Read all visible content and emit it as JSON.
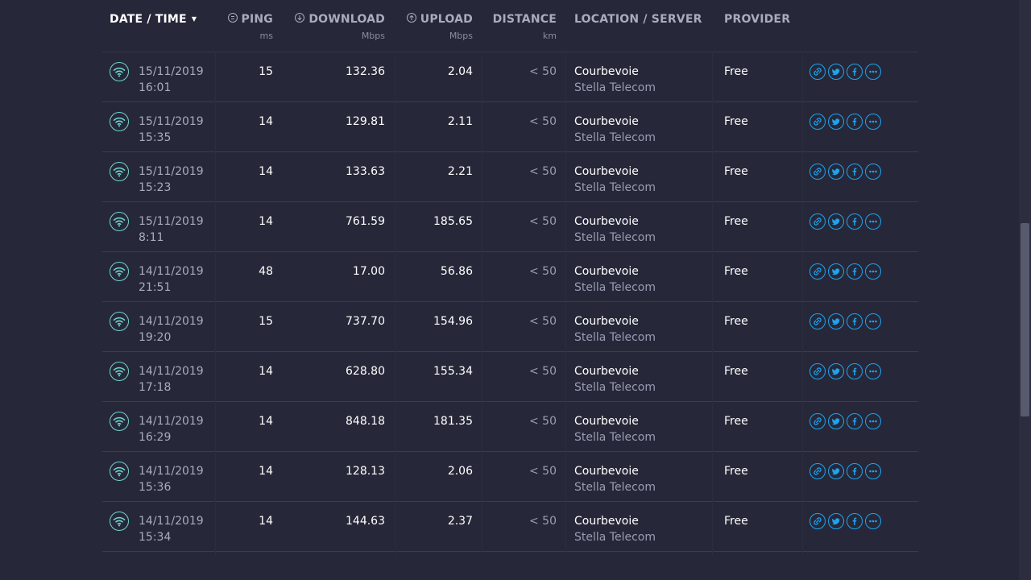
{
  "headers": {
    "datetime": "DATE / TIME",
    "ping": "PING",
    "ping_unit": "ms",
    "download": "DOWNLOAD",
    "download_unit": "Mbps",
    "upload": "UPLOAD",
    "upload_unit": "Mbps",
    "distance": "DISTANCE",
    "distance_unit": "km",
    "location": "LOCATION / SERVER",
    "provider": "PROVIDER"
  },
  "rows": [
    {
      "date": "15/11/2019",
      "time": "16:01",
      "ping": "15",
      "download": "132.36",
      "upload": "2.04",
      "distance": "< 50",
      "location": "Courbevoie",
      "server": "Stella Telecom",
      "provider": "Free"
    },
    {
      "date": "15/11/2019",
      "time": "15:35",
      "ping": "14",
      "download": "129.81",
      "upload": "2.11",
      "distance": "< 50",
      "location": "Courbevoie",
      "server": "Stella Telecom",
      "provider": "Free"
    },
    {
      "date": "15/11/2019",
      "time": "15:23",
      "ping": "14",
      "download": "133.63",
      "upload": "2.21",
      "distance": "< 50",
      "location": "Courbevoie",
      "server": "Stella Telecom",
      "provider": "Free"
    },
    {
      "date": "15/11/2019",
      "time": "8:11",
      "ping": "14",
      "download": "761.59",
      "upload": "185.65",
      "distance": "< 50",
      "location": "Courbevoie",
      "server": "Stella Telecom",
      "provider": "Free"
    },
    {
      "date": "14/11/2019",
      "time": "21:51",
      "ping": "48",
      "download": "17.00",
      "upload": "56.86",
      "distance": "< 50",
      "location": "Courbevoie",
      "server": "Stella Telecom",
      "provider": "Free"
    },
    {
      "date": "14/11/2019",
      "time": "19:20",
      "ping": "15",
      "download": "737.70",
      "upload": "154.96",
      "distance": "< 50",
      "location": "Courbevoie",
      "server": "Stella Telecom",
      "provider": "Free"
    },
    {
      "date": "14/11/2019",
      "time": "17:18",
      "ping": "14",
      "download": "628.80",
      "upload": "155.34",
      "distance": "< 50",
      "location": "Courbevoie",
      "server": "Stella Telecom",
      "provider": "Free"
    },
    {
      "date": "14/11/2019",
      "time": "16:29",
      "ping": "14",
      "download": "848.18",
      "upload": "181.35",
      "distance": "< 50",
      "location": "Courbevoie",
      "server": "Stella Telecom",
      "provider": "Free"
    },
    {
      "date": "14/11/2019",
      "time": "15:36",
      "ping": "14",
      "download": "128.13",
      "upload": "2.06",
      "distance": "< 50",
      "location": "Courbevoie",
      "server": "Stella Telecom",
      "provider": "Free"
    },
    {
      "date": "14/11/2019",
      "time": "15:34",
      "ping": "14",
      "download": "144.63",
      "upload": "2.37",
      "distance": "< 50",
      "location": "Courbevoie",
      "server": "Stella Telecom",
      "provider": "Free"
    }
  ],
  "row_icon": "wifi-icon",
  "row_actions": [
    "link-icon",
    "twitter-icon",
    "facebook-icon",
    "more-icon"
  ],
  "colors": {
    "background": "#262839",
    "accent_blue": "#1fa3ef",
    "wifi_cyan": "#6fd6d0",
    "muted_text": "#9a9cb2"
  }
}
